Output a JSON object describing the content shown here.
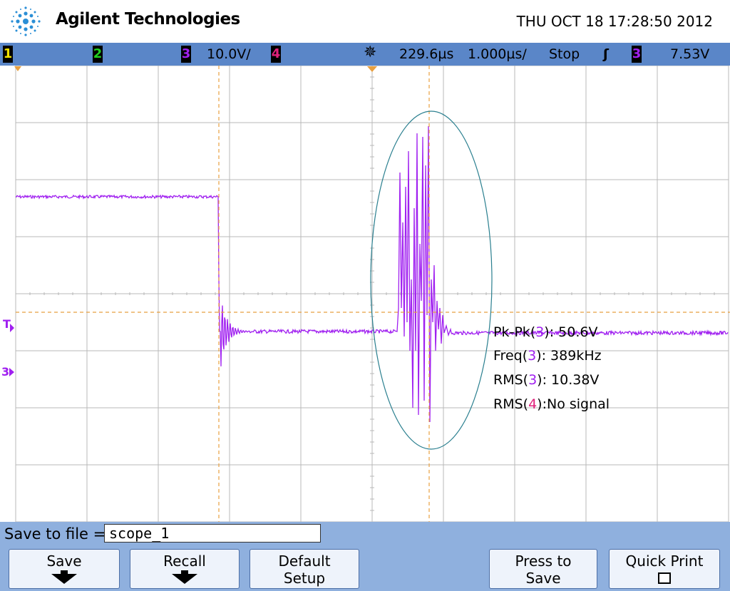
{
  "header": {
    "brand": "Agilent Technologies",
    "datetime": "THU OCT 18 17:28:50 2012"
  },
  "status": {
    "ch1": "1",
    "ch2": "2",
    "ch3": "3",
    "ch3_scale": "10.0V/",
    "ch4": "4",
    "delay": "229.6µs",
    "timebase": "1.000µs/",
    "run_state": "Stop",
    "trigger_slope_symbol": "ʃ",
    "trigger_source": "3",
    "trigger_level": "7.53V"
  },
  "markers": {
    "trigger": "T",
    "ch3_ground": "3"
  },
  "measurements": [
    {
      "name": "Pk-Pk(",
      "ch": "3",
      "suffix": "): 50.6V"
    },
    {
      "name": "Freq(",
      "ch": "3",
      "suffix": "): 389kHz"
    },
    {
      "name": "RMS(",
      "ch": "3",
      "suffix": "): 10.38V"
    },
    {
      "name": "RMS(",
      "ch": "4",
      "suffix": "):No signal"
    }
  ],
  "save": {
    "label": "Save to file =",
    "filename": "scope_1"
  },
  "softkeys": {
    "save": "Save",
    "recall": "Recall",
    "default_1": "Default",
    "default_2": "Setup",
    "press_1": "Press to",
    "press_2": "Save",
    "quick_print": "Quick Print"
  },
  "colors": {
    "ch1": "#f0e000",
    "ch2": "#20d020",
    "ch3": "#a020f0",
    "ch4": "#e0207a",
    "cursor": "#e8a040",
    "annotation": "#2a7f8f",
    "grid": "#b8b8b8"
  }
}
